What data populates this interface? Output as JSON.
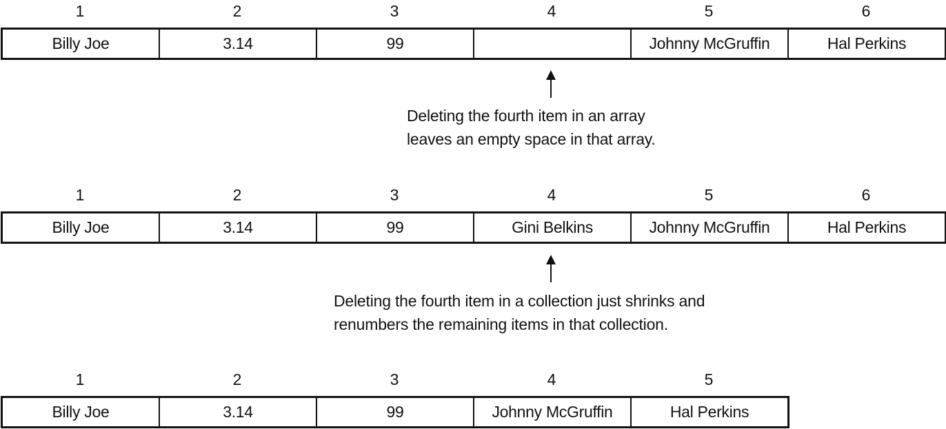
{
  "arrays": [
    {
      "indices": [
        "1",
        "2",
        "3",
        "4",
        "5",
        "6"
      ],
      "cells": [
        "Billy Joe",
        "3.14",
        "99",
        "",
        "Johnny McGruffin",
        "Hal Perkins"
      ]
    },
    {
      "indices": [
        "1",
        "2",
        "3",
        "4",
        "5",
        "6"
      ],
      "cells": [
        "Billy Joe",
        "3.14",
        "99",
        "Gini Belkins",
        "Johnny McGruffin",
        "Hal Perkins"
      ]
    },
    {
      "indices": [
        "1",
        "2",
        "3",
        "4",
        "5"
      ],
      "cells": [
        "Billy Joe",
        "3.14",
        "99",
        "Johnny McGruffin",
        "Hal Perkins"
      ]
    }
  ],
  "captions": [
    {
      "lines": [
        "Deleting the fourth item in an array",
        "leaves an empty space in that array."
      ]
    },
    {
      "lines": [
        "Deleting the fourth item in a collection just shrinks and",
        "renumbers the remaining items in that collection."
      ]
    }
  ]
}
